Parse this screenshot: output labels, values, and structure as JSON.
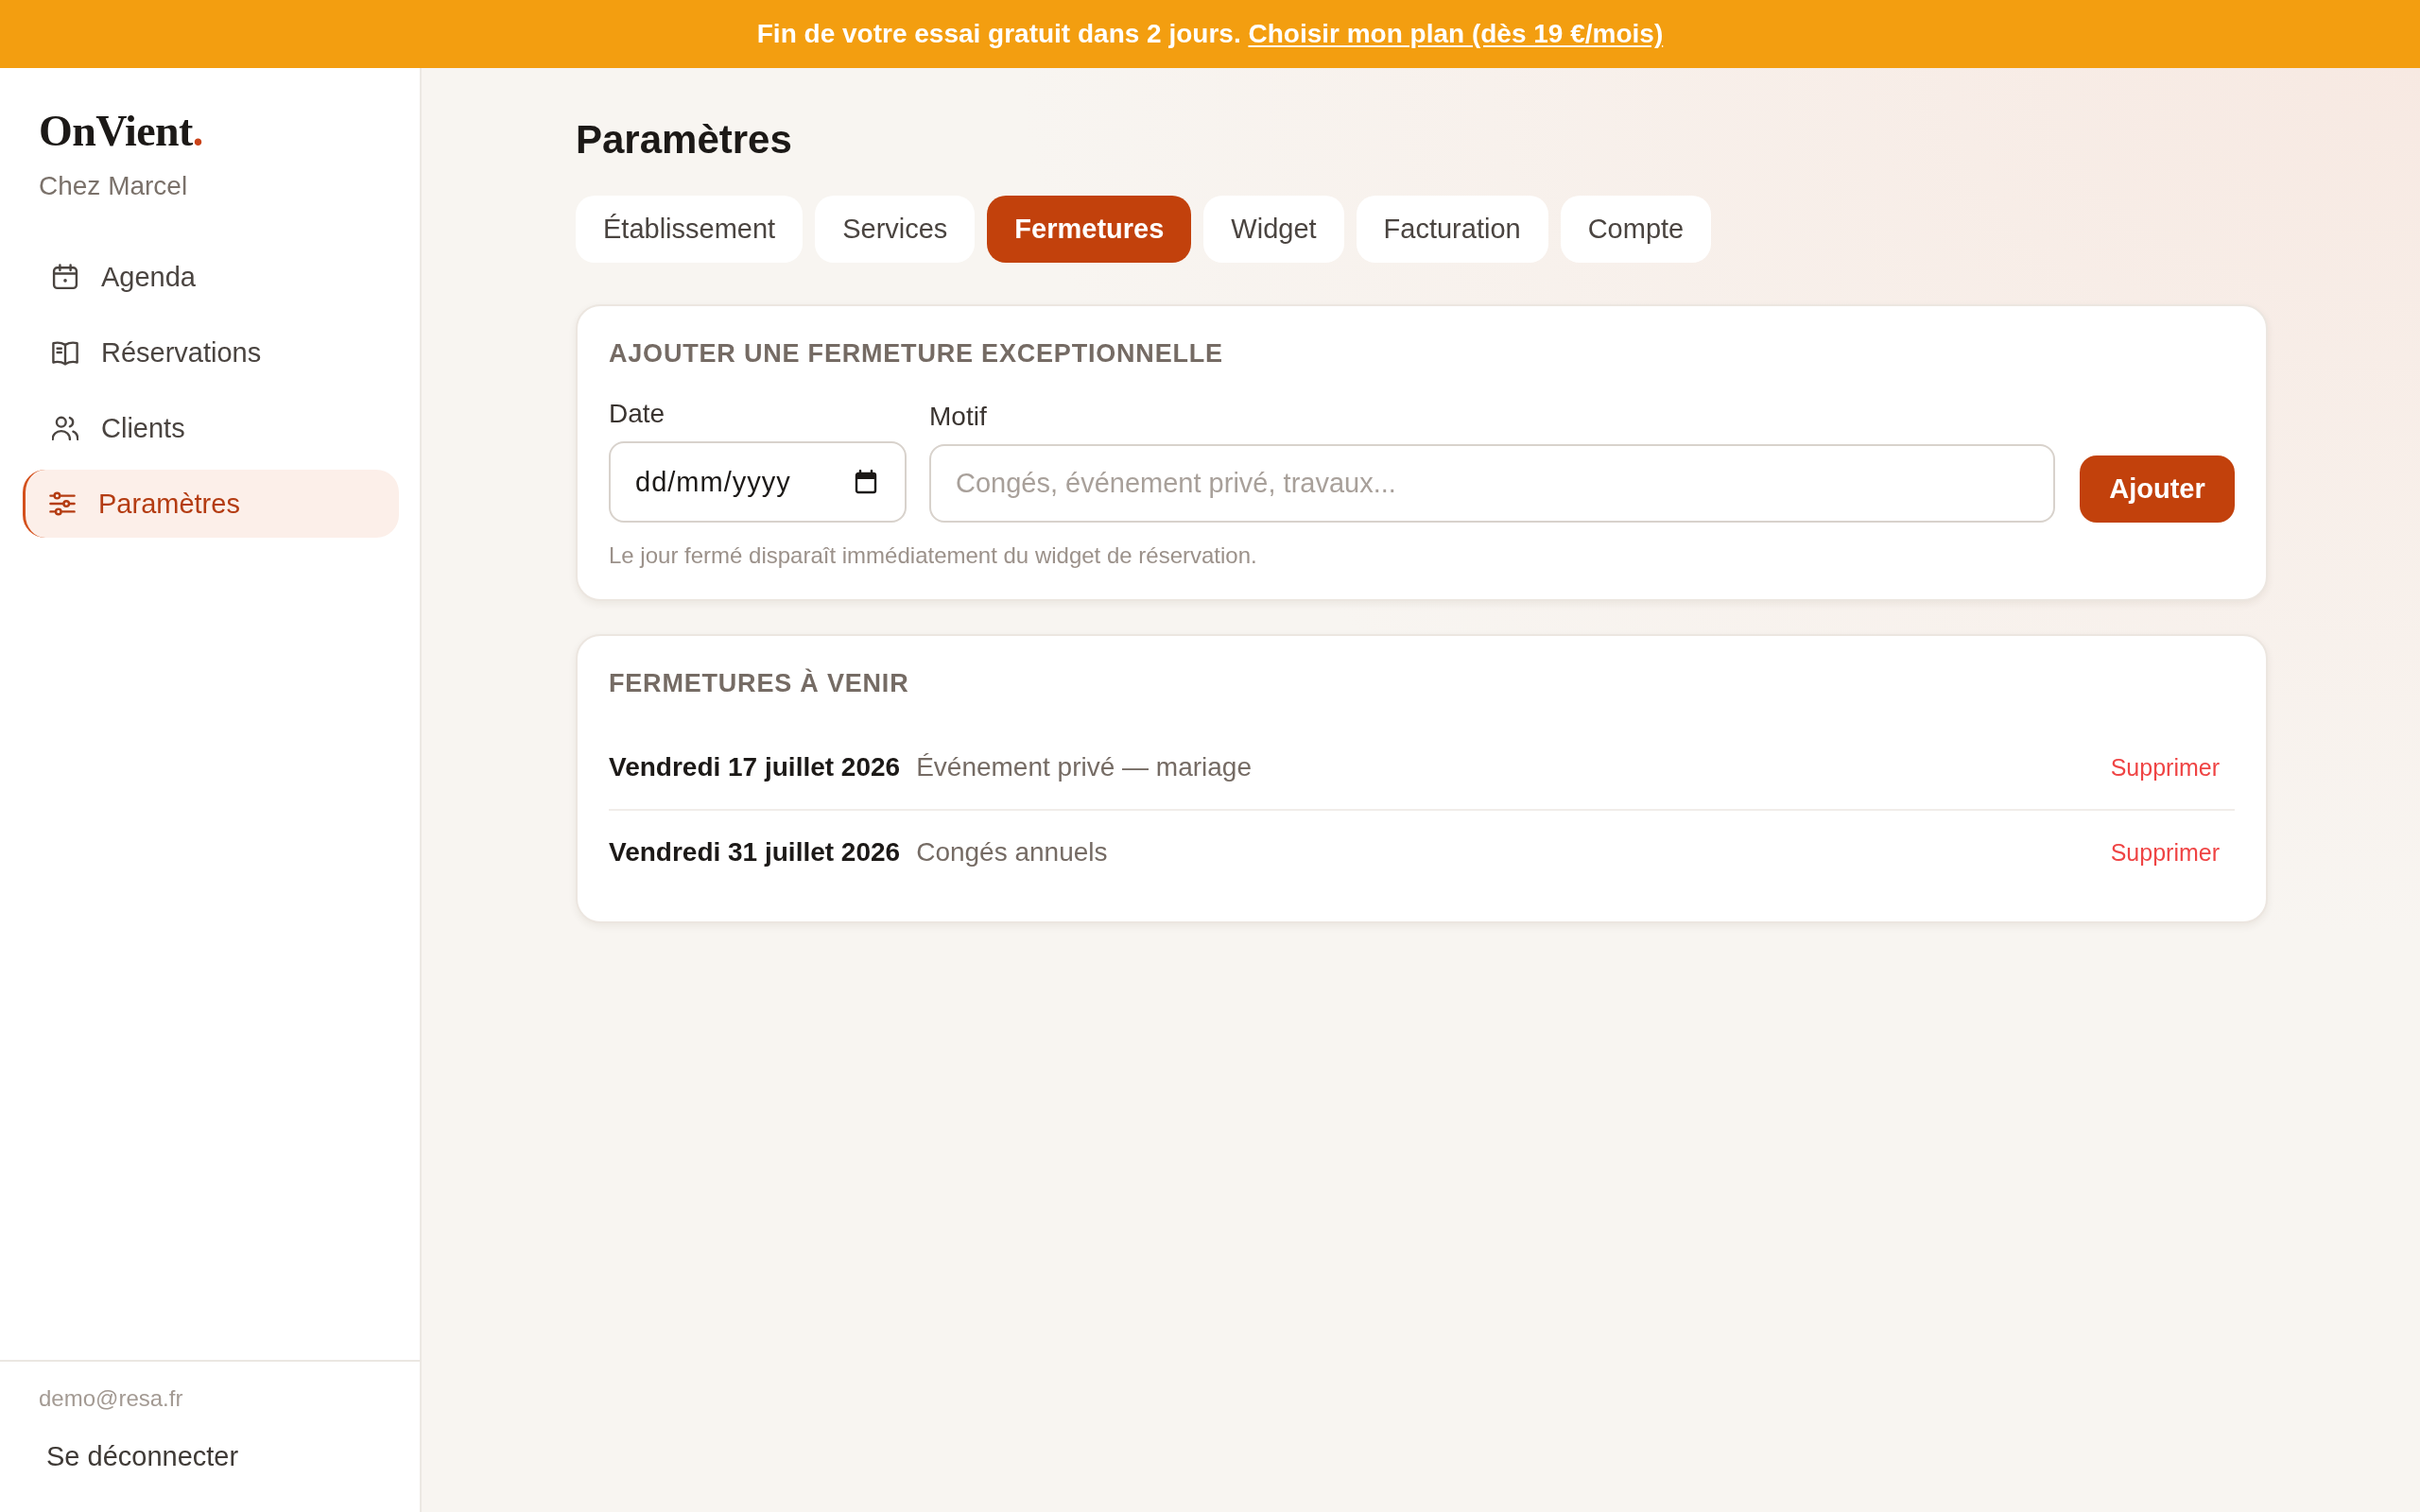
{
  "banner": {
    "text": "Fin de votre essai gratuit dans 2 jours.",
    "link": "Choisir mon plan (dès 19 €/mois)"
  },
  "sidebar": {
    "logo": {
      "name": "OnVient",
      "accent": "."
    },
    "venue": "Chez Marcel",
    "items": [
      {
        "label": "Agenda",
        "selected": false
      },
      {
        "label": "Réservations",
        "selected": false
      },
      {
        "label": "Clients",
        "selected": false
      },
      {
        "label": "Paramètres",
        "selected": true
      }
    ],
    "account": {
      "email": "demo@resa.fr",
      "logout": "Se déconnecter"
    }
  },
  "page": {
    "title": "Paramètres",
    "tabs": [
      {
        "label": "Établissement",
        "selected": false
      },
      {
        "label": "Services",
        "selected": false
      },
      {
        "label": "Fermetures",
        "selected": true
      },
      {
        "label": "Widget",
        "selected": false
      },
      {
        "label": "Facturation",
        "selected": false
      },
      {
        "label": "Compte",
        "selected": false
      }
    ]
  },
  "add_closure": {
    "heading": "AJOUTER UNE FERMETURE EXCEPTIONNELLE",
    "date": {
      "label": "Date",
      "placeholder": "dd/mm/yyyy"
    },
    "reason": {
      "label": "Motif",
      "placeholder": "Congés, événement privé, travaux..."
    },
    "submit": "Ajouter",
    "hint": "Le jour fermé disparaît immédiatement du widget de réservation."
  },
  "upcoming": {
    "heading": "FERMETURES À VENIR",
    "rows": [
      {
        "date": "Vendredi 17 juillet 2026",
        "reason": "Événement privé — mariage",
        "action": "Supprimer"
      },
      {
        "date": "Vendredi 31 juillet 2026",
        "reason": "Congés annuels",
        "action": "Supprimer"
      }
    ]
  }
}
